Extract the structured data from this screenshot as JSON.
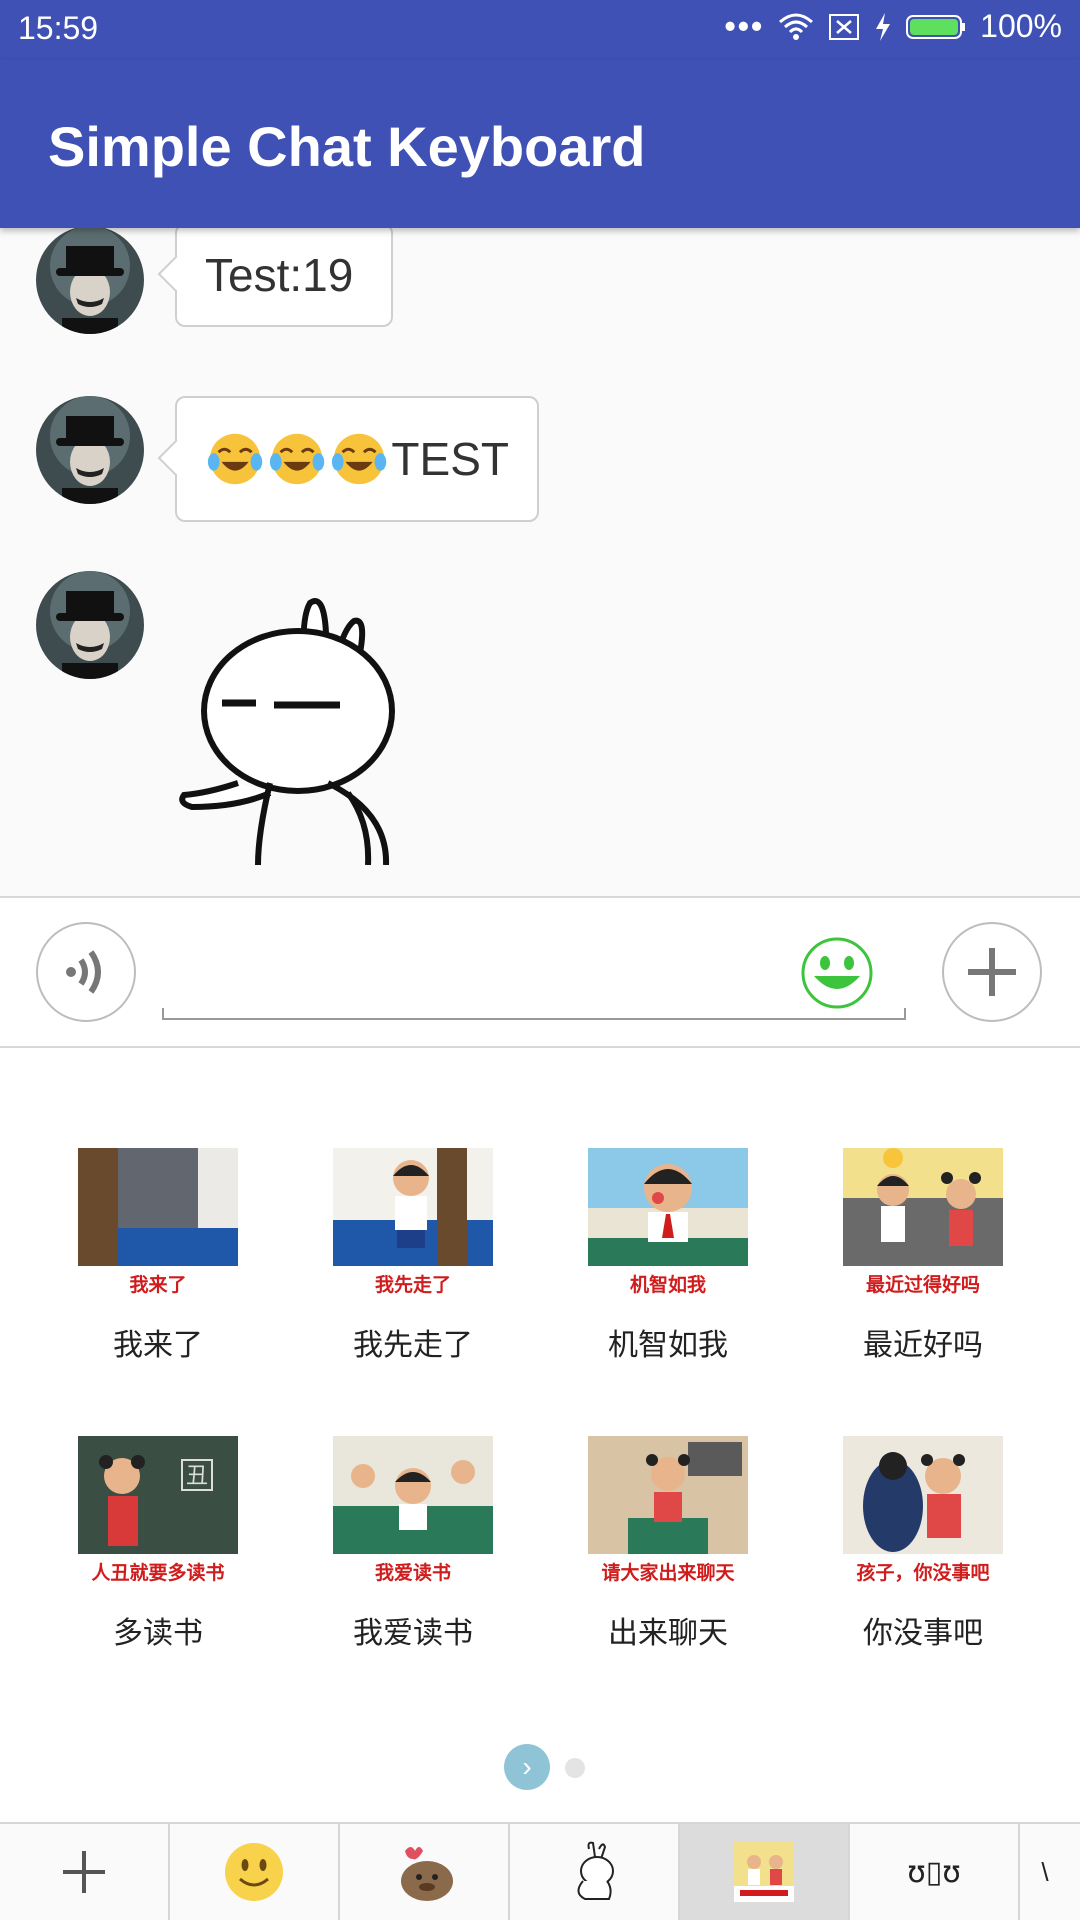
{
  "status_bar": {
    "time": "15:59",
    "battery": "100%"
  },
  "app_bar": {
    "title": "Simple Chat Keyboard"
  },
  "messages": [
    {
      "type": "text",
      "text": "Test:19"
    },
    {
      "type": "emoji_text",
      "emoji_icon": "face-with-tears-of-joy",
      "emoji_count": 3,
      "text": "TEST"
    },
    {
      "type": "sticker",
      "sticker_icon": "rabbit-sticker"
    }
  ],
  "input": {
    "value": "",
    "placeholder": ""
  },
  "sticker_grid": [
    {
      "caption": "我来了",
      "label": "我来了"
    },
    {
      "caption": "我先走了",
      "label": "我先走了"
    },
    {
      "caption": "机智如我",
      "label": "机智如我"
    },
    {
      "caption": "最近过得好吗",
      "label": "最近好吗"
    },
    {
      "caption": "人丑就要多读书",
      "label": "多读书"
    },
    {
      "caption": "我爱读书",
      "label": "我爱读书"
    },
    {
      "caption": "请大家出来聊天",
      "label": "出来聊天"
    },
    {
      "caption": "孩子，你没事吧",
      "label": "你没事吧"
    }
  ],
  "pager": {
    "pages": 2,
    "current": 1
  },
  "tabs": [
    {
      "icon": "plus-icon"
    },
    {
      "icon": "smiley-icon"
    },
    {
      "icon": "cartoon-sticker-icon"
    },
    {
      "icon": "rabbit-sticker-icon"
    },
    {
      "icon": "retro-sticker-icon",
      "selected": true
    },
    {
      "icon": "kaomoji-icon",
      "text": "ʊ▯ʊ"
    }
  ],
  "colors": {
    "primary": "#3f51b5",
    "accent_green": "#3cc43c",
    "caption_red": "#d01c1c"
  }
}
